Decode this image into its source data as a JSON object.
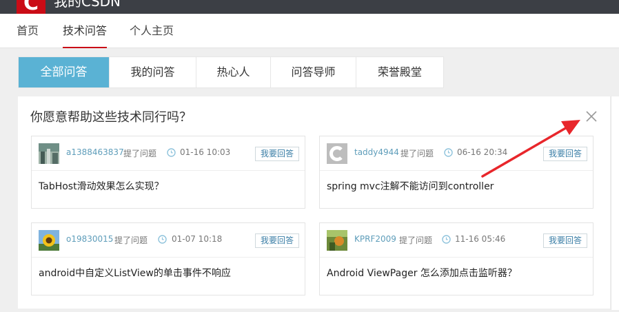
{
  "app": {
    "title": "我的CSDN",
    "logo_letter": "C"
  },
  "nav": {
    "items": [
      "首页",
      "技术问答",
      "个人主页"
    ],
    "active_index": 1
  },
  "tabs": {
    "items": [
      "全部问答",
      "我的问答",
      "热心人",
      "问答导师",
      "荣誉殿堂"
    ],
    "active_index": 0
  },
  "panel": {
    "title": "你愿意帮助这些技术同行吗？",
    "close_icon": "close-x-icon",
    "questions": [
      {
        "user": "a1388463837",
        "action": "提了问题",
        "time": "01-16 10:03",
        "button": "我要回答",
        "title": "TabHost滑动效果怎么实现？"
      },
      {
        "user": "taddy4944",
        "action": "提了问题",
        "time": "06-16 20:34",
        "button": "我要回答",
        "title": "spring mvc注解不能访问到controller"
      },
      {
        "user": "o19830015",
        "action": "提了问题",
        "time": "01-07 10:18",
        "button": "我要回答",
        "title": "android中自定义ListView的单击事件不响应"
      },
      {
        "user": "KPRF2009",
        "action": "提了问题",
        "time": "11-16 05:46",
        "button": "我要回答",
        "title": "Android ViewPager 怎么添加点击监听器？"
      }
    ]
  },
  "colors": {
    "brand_red": "#ca0c16",
    "tab_active": "#5ab2d4",
    "username": "#5e9dba",
    "annotation_arrow": "#e8262b"
  }
}
